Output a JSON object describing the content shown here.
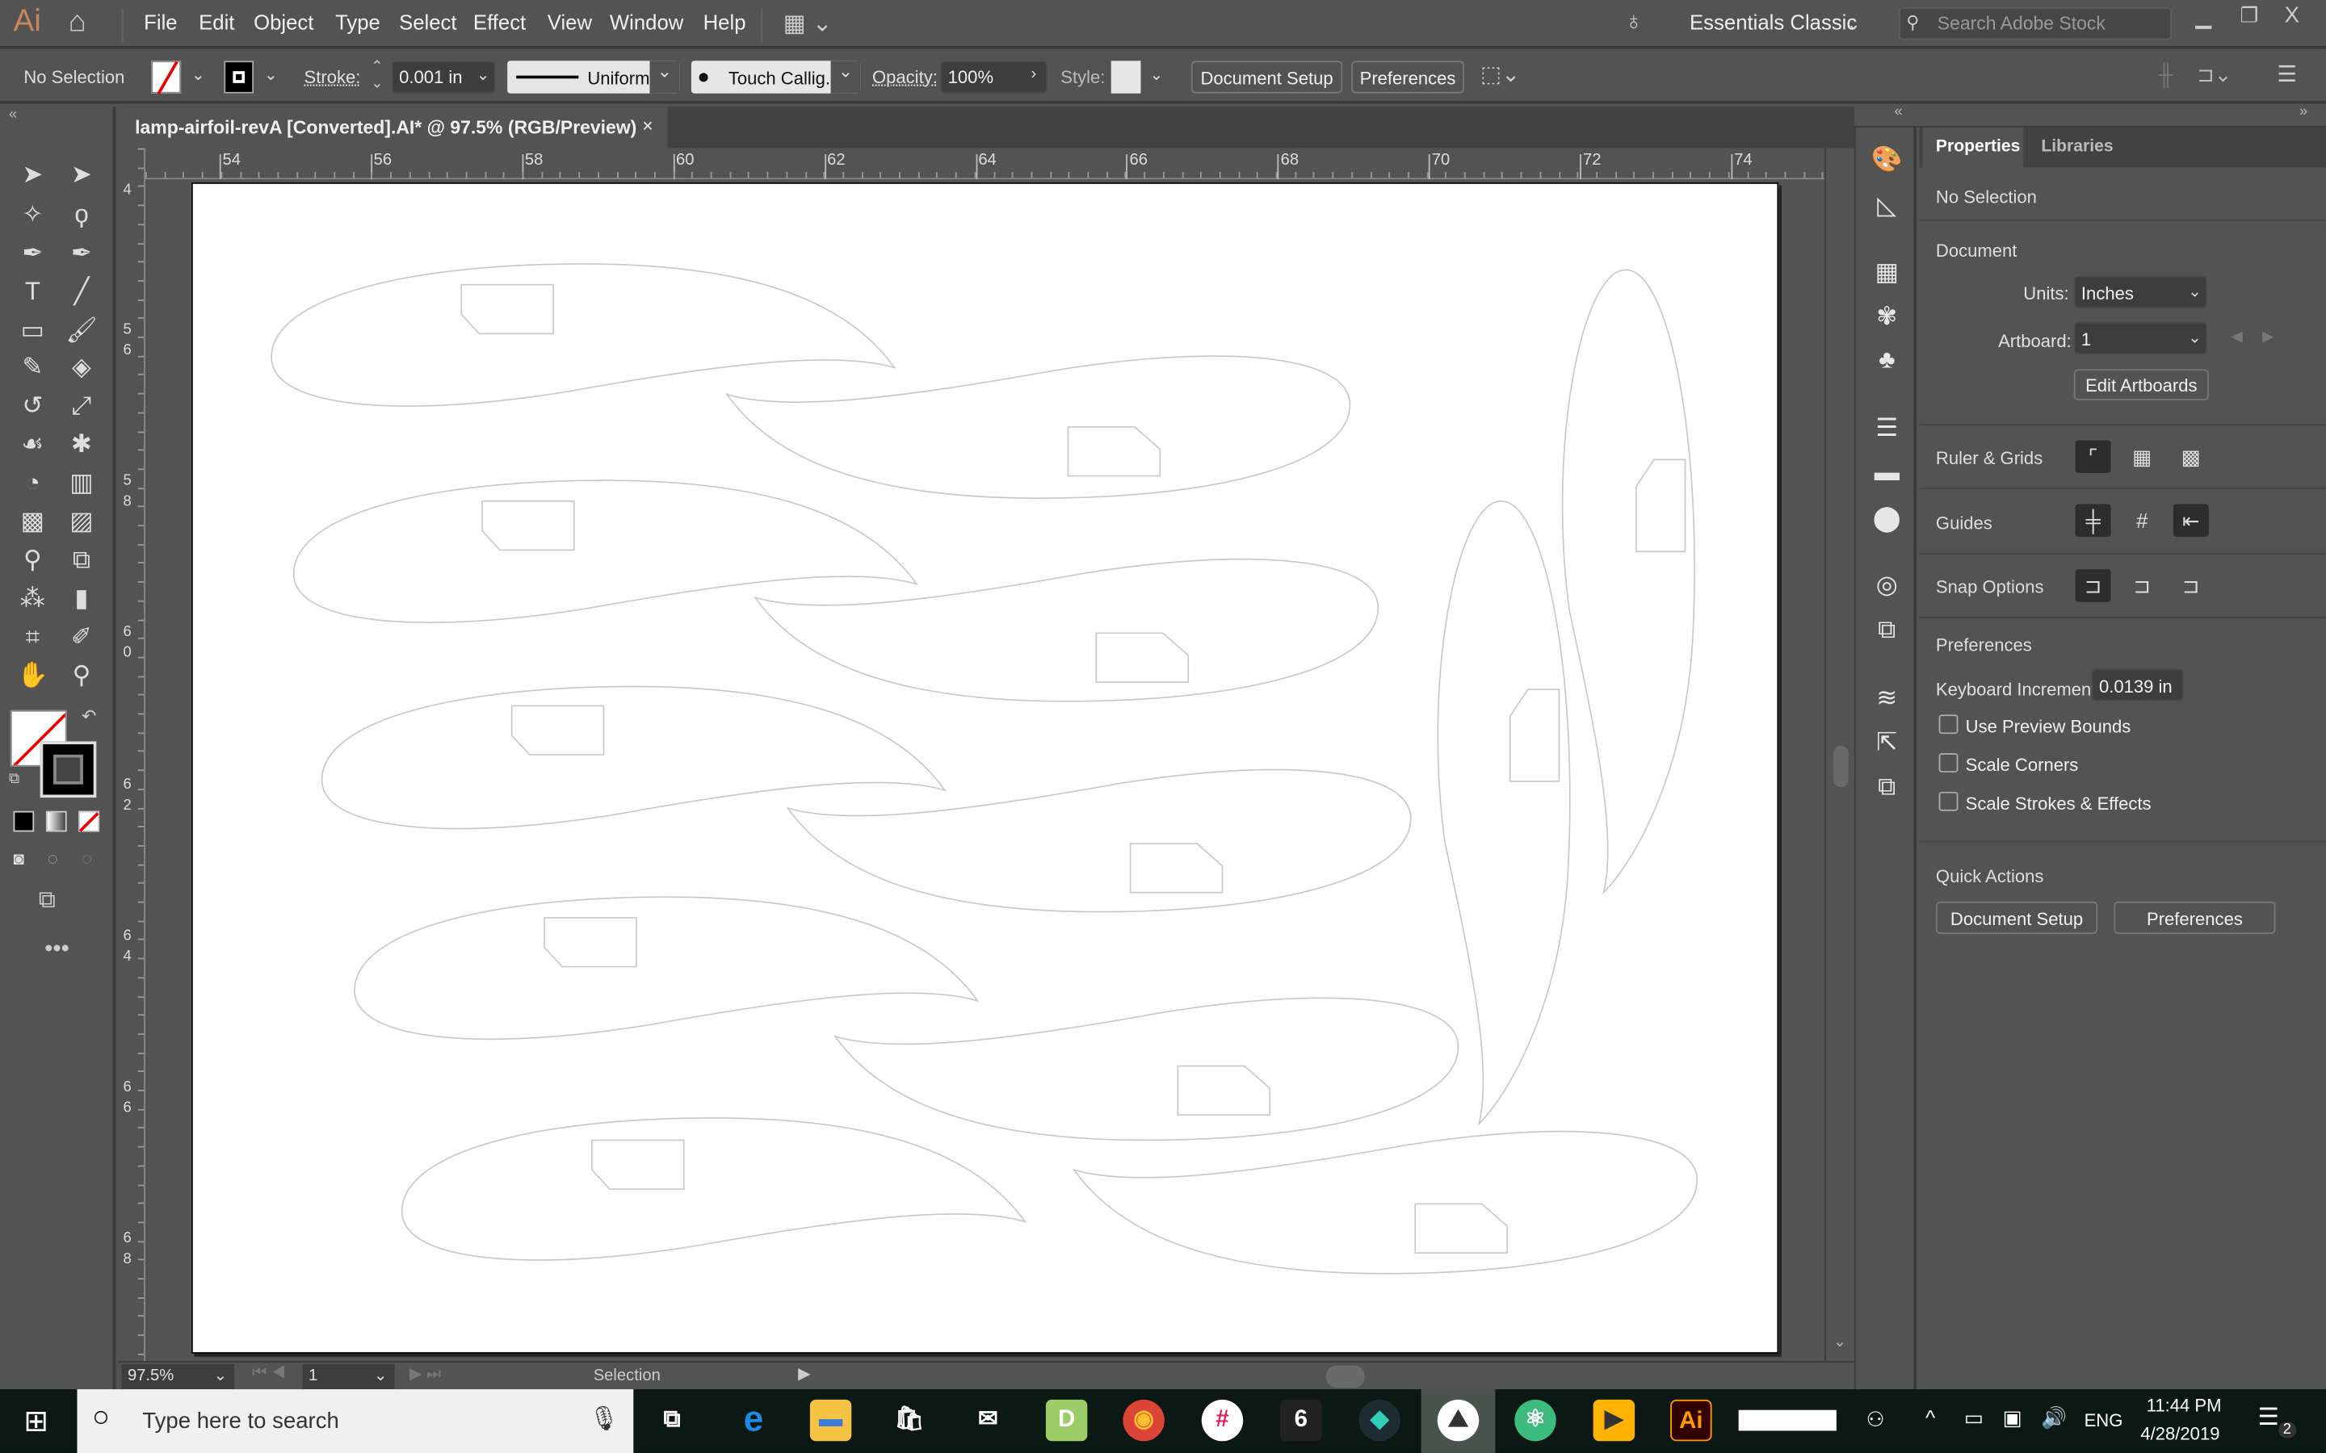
{
  "app": {
    "logo": "Ai",
    "menus": [
      "File",
      "Edit",
      "Object",
      "Type",
      "Select",
      "Effect",
      "View",
      "Window",
      "Help"
    ],
    "workspace": "Essentials Classic",
    "search_placeholder": "Search Adobe Stock"
  },
  "control_bar": {
    "selection": "No Selection",
    "stroke_label": "Stroke:",
    "stroke_value": "0.001 in",
    "profile": "Uniform",
    "brush": "Touch Callig...",
    "opacity_label": "Opacity:",
    "opacity_value": "100%",
    "style_label": "Style:",
    "document_setup": "Document Setup",
    "preferences": "Preferences"
  },
  "document": {
    "tab_title": "lamp-airfoil-revA [Converted].AI* @ 97.5% (RGB/Preview)",
    "close": "×"
  },
  "rulers": {
    "top": [
      "54",
      "56",
      "58",
      "60",
      "62",
      "64",
      "66",
      "68",
      "70",
      "72",
      "74"
    ],
    "left": [
      "4",
      "56",
      "58",
      "60",
      "62",
      "64",
      "66",
      "68"
    ]
  },
  "status": {
    "zoom": "97.5%",
    "artboard": "1",
    "tool": "Selection"
  },
  "properties": {
    "tabs": [
      "Properties",
      "Libraries"
    ],
    "selection": "No Selection",
    "document_title": "Document",
    "units_label": "Units:",
    "units_value": "Inches",
    "artboard_label": "Artboard:",
    "artboard_value": "1",
    "edit_artboards": "Edit Artboards",
    "ruler_grids": "Ruler & Grids",
    "guides": "Guides",
    "snap_options": "Snap Options",
    "preferences_title": "Preferences",
    "keyboard_increment_label": "Keyboard Increment:",
    "keyboard_increment_value": "0.0139 in",
    "checkboxes": [
      {
        "label": "Use Preview Bounds",
        "checked": false
      },
      {
        "label": "Scale Corners",
        "checked": false
      },
      {
        "label": "Scale Strokes & Effects",
        "checked": false
      }
    ],
    "quick_actions": "Quick Actions",
    "qa_document_setup": "Document Setup",
    "qa_preferences": "Preferences"
  },
  "taskbar": {
    "search_placeholder": "Type here to search",
    "language": "ENG",
    "time": "11:44 PM",
    "date": "4/28/2019",
    "notifications": "2"
  },
  "colors": {
    "accent_ai": "#ff9a00",
    "ui_bg": "#535353",
    "artboard": "#ffffff",
    "taskbar": "#0b1813"
  }
}
